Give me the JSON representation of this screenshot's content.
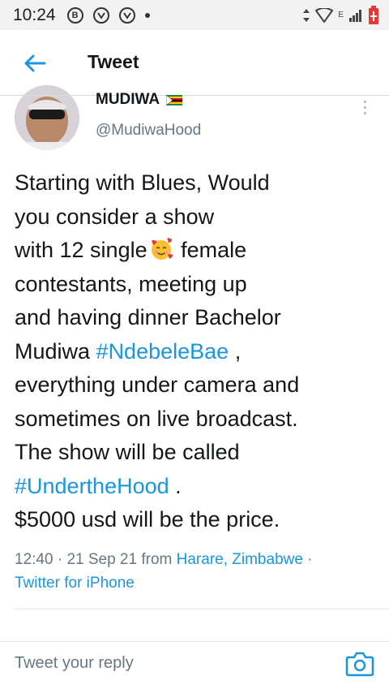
{
  "status_bar": {
    "time": "10:24",
    "icons": [
      "b-icon",
      "app-icon",
      "app-icon",
      "dot"
    ],
    "network": "E"
  },
  "header": {
    "title": "Tweet"
  },
  "tweet": {
    "display_name": "MUDIWA",
    "handle": "@MudiwaHood",
    "text_lines": [
      [
        "Starting with Blues, Would"
      ],
      [
        "you consider a show"
      ],
      [
        "with 12 single",
        " female"
      ],
      [
        "contestants, meeting up"
      ],
      [
        "and having dinner Bachelor"
      ],
      [
        "Mudiwa ",
        "#NdebeleBae",
        " ,"
      ],
      [
        "everything under camera and"
      ],
      [
        "sometimes on live broadcast."
      ],
      [
        "The show will be called"
      ],
      [
        "#UndertheHood",
        " ."
      ],
      [
        "$5000 usd will be the price."
      ]
    ],
    "meta": {
      "time": "12:40",
      "sep1": " · ",
      "date": "21 Sep 21",
      "from": " from ",
      "location": "Harare, Zimbabwe",
      "sep2": " ·",
      "source": "Twitter for iPhone"
    }
  },
  "reply": {
    "placeholder": "Tweet your reply"
  },
  "colors": {
    "accent": "#1b95e0",
    "text": "#14171a",
    "muted": "#657786"
  }
}
